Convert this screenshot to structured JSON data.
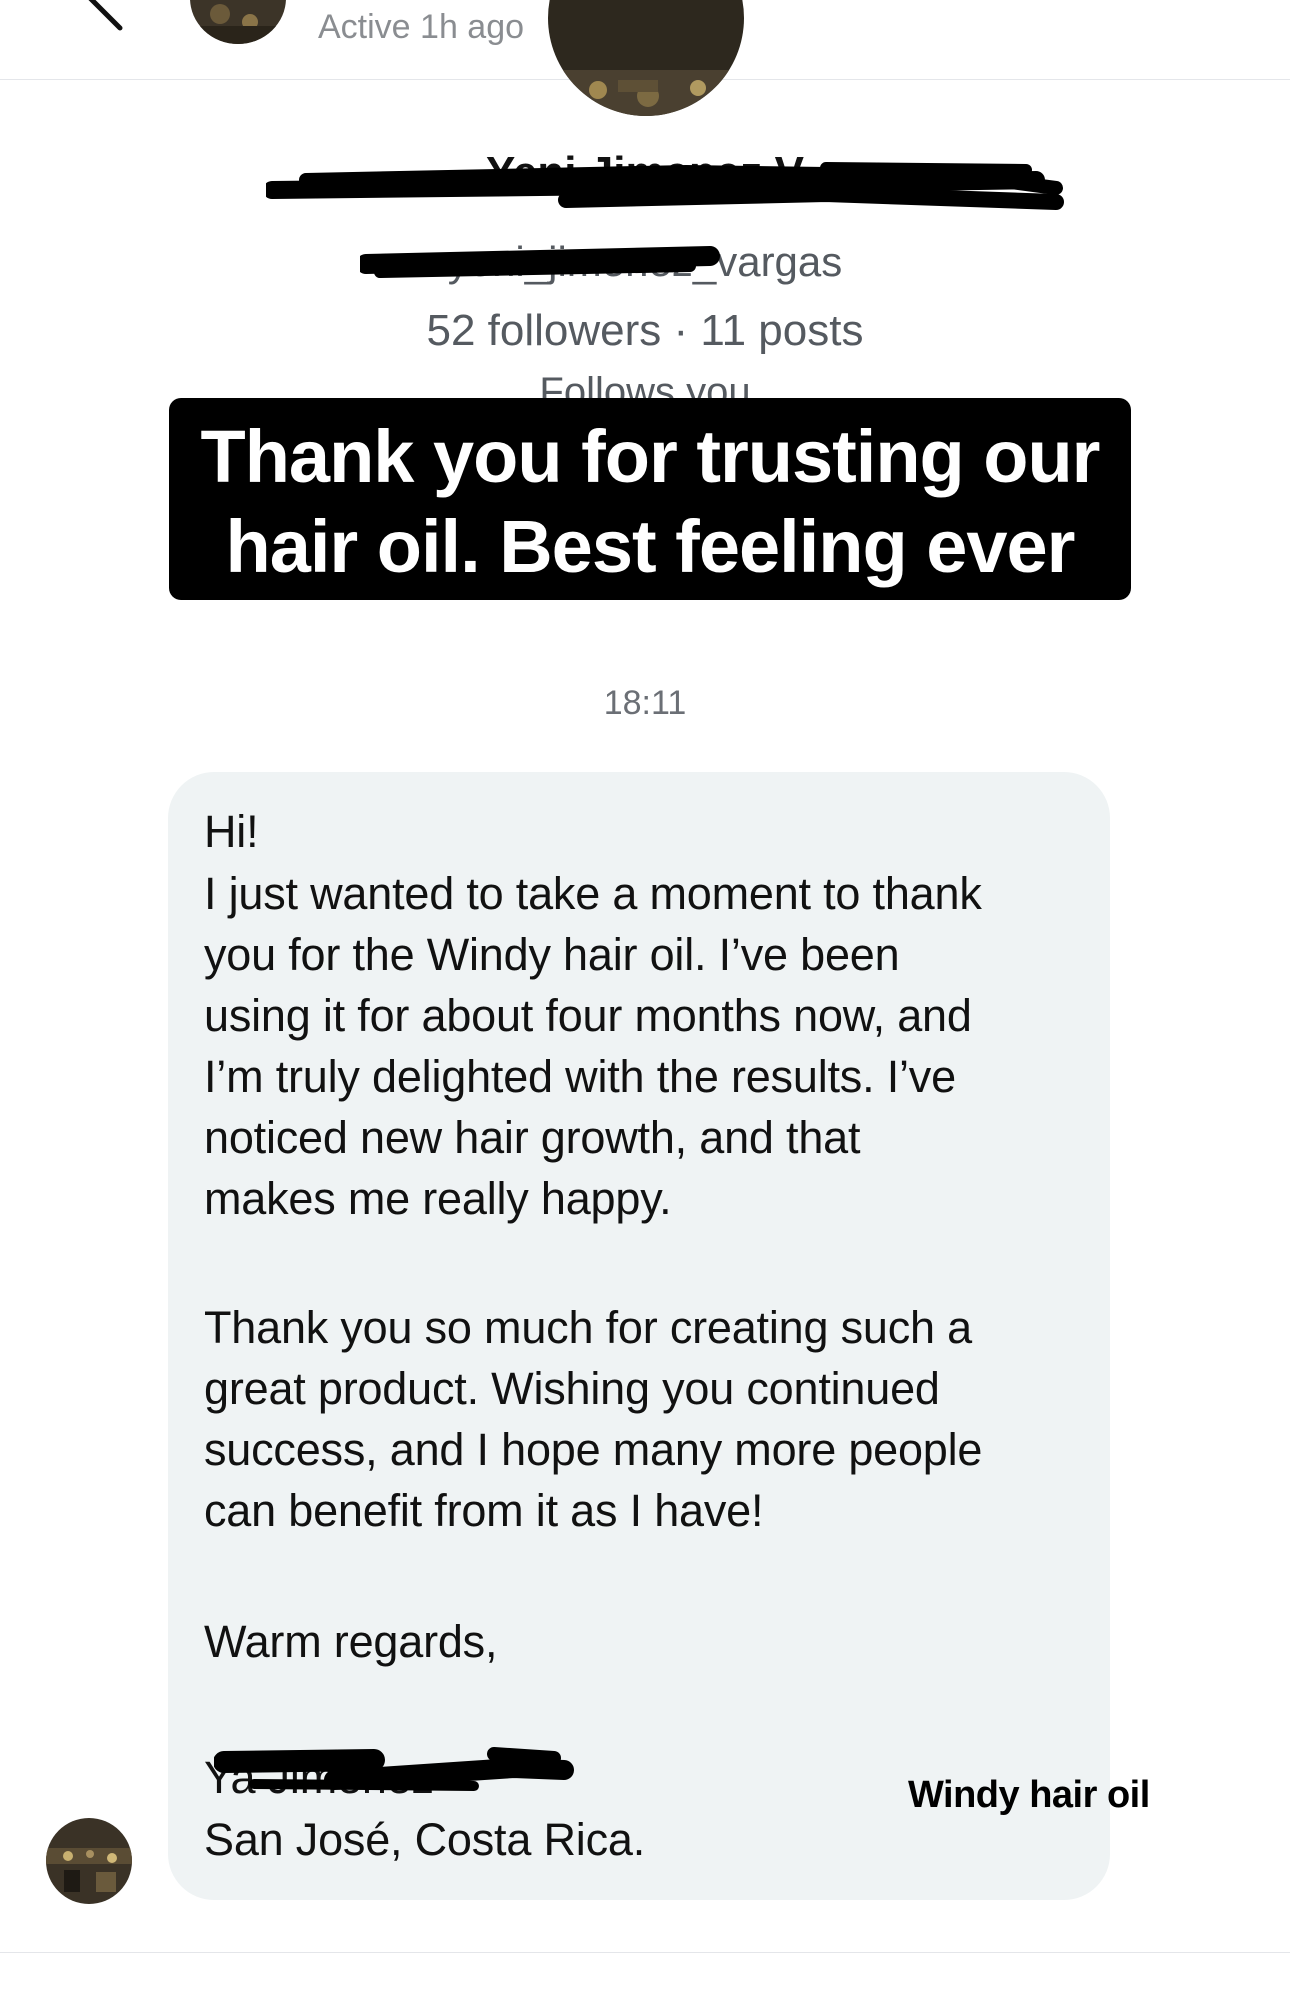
{
  "header": {
    "status": "Active 1h ago"
  },
  "profile": {
    "name": "Yeni Jimenez V",
    "username": "yeni_jimenez_vargas",
    "stats": "52 followers · 11 posts",
    "follows_you": "Follows you"
  },
  "caption": {
    "line1": "Thank you for trusting our",
    "line2": "hair oil. Best feeling ever"
  },
  "timestamp": "18:11",
  "message": {
    "lines": [
      "Hi!",
      "I just wanted to take a moment to thank",
      "you for the Windy hair oil. I’ve been",
      "using it for about four months now, and",
      "I’m truly delighted with the results. I’ve",
      "noticed new hair growth, and that",
      "makes me really happy.",
      "Thank you so much for creating such a",
      "great product. Wishing you continued",
      "success, and I hope many more people",
      "can benefit from it as I have!",
      "Warm regards,",
      "Ya Jimenez",
      "San José, Costa Rica."
    ]
  },
  "watermark": "Windy hair oil",
  "colors": {
    "bubble": "#eff3f4",
    "caption_bg": "#000000",
    "secondary_text": "#555a60"
  }
}
